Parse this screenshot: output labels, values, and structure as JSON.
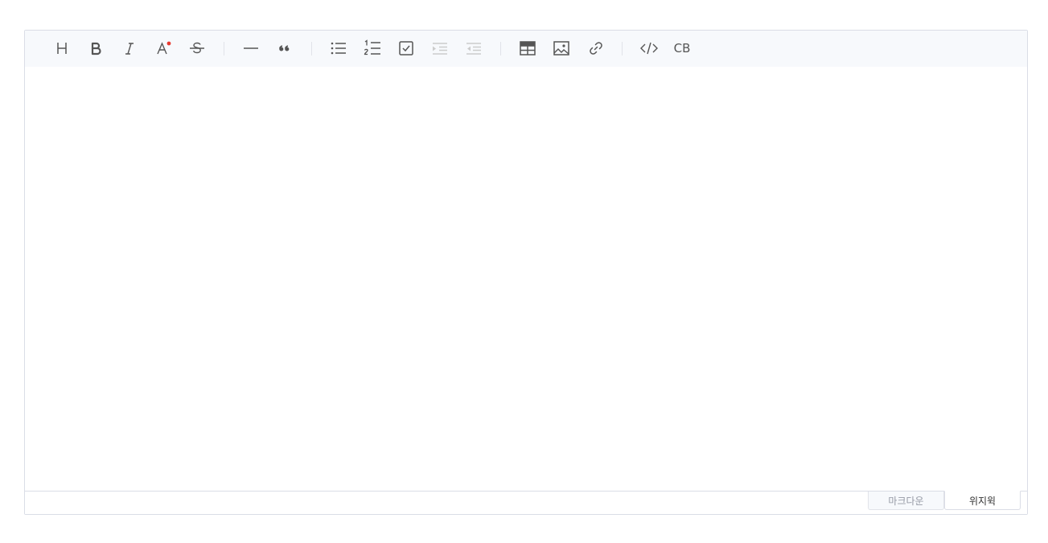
{
  "toolbar": {
    "heading": {
      "icon": "heading-icon"
    },
    "bold": {
      "icon": "bold-icon"
    },
    "italic": {
      "icon": "italic-icon"
    },
    "text_color": {
      "icon": "text-color-icon",
      "accent": "#e73a30"
    },
    "strike": {
      "icon": "strikethrough-icon"
    },
    "hr": {
      "icon": "horizontal-rule-icon"
    },
    "quote": {
      "icon": "blockquote-icon"
    },
    "bullet_list": {
      "icon": "bullet-list-icon"
    },
    "ordered_list": {
      "icon": "ordered-list-icon"
    },
    "task": {
      "icon": "task-checkbox-icon"
    },
    "indent": {
      "icon": "indent-icon",
      "disabled": true
    },
    "outdent": {
      "icon": "outdent-icon",
      "disabled": true
    },
    "table": {
      "icon": "table-icon"
    },
    "image": {
      "icon": "image-icon"
    },
    "link": {
      "icon": "link-icon"
    },
    "code": {
      "icon": "code-icon"
    },
    "code_block_label": "CB"
  },
  "mode_tabs": {
    "markdown": "마크다운",
    "wysiwyg": "위지윅",
    "active": "wysiwyg"
  },
  "colors": {
    "toolbar_bg": "#f7f9fc",
    "border": "#dadde6",
    "icon": "#555555",
    "disabled_icon": "#cccccc"
  }
}
